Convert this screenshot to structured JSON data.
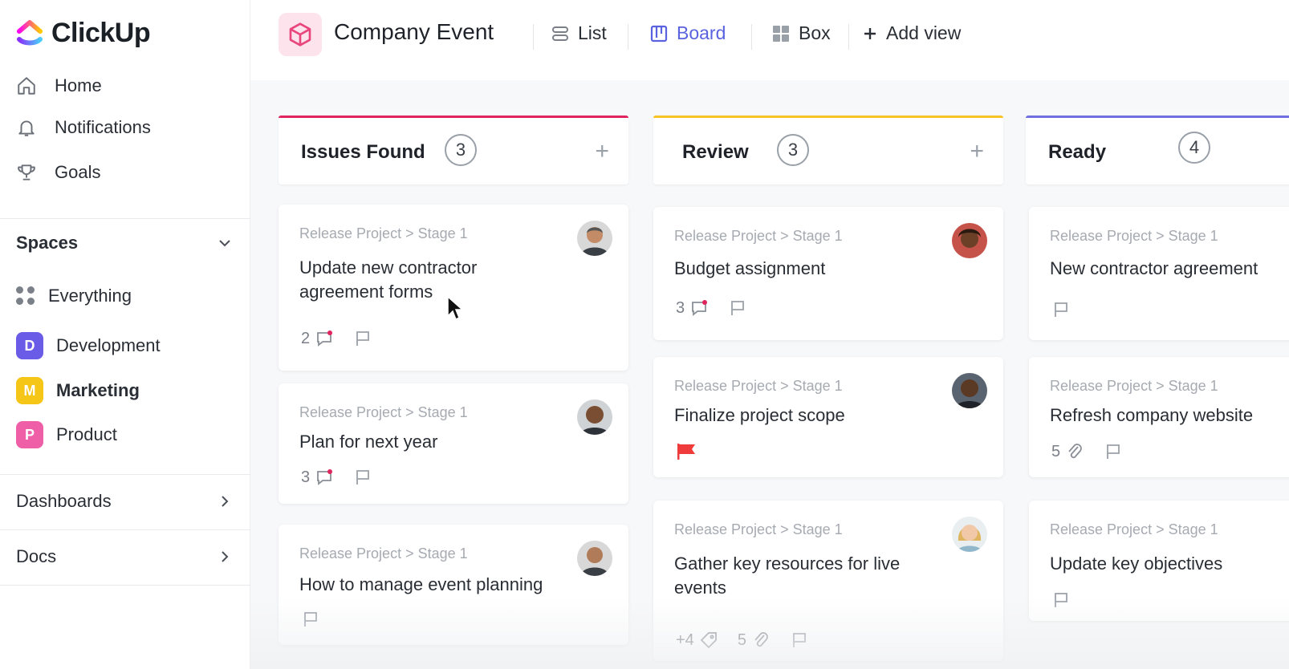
{
  "app": {
    "name": "ClickUp"
  },
  "sidebar": {
    "nav": [
      {
        "label": "Home",
        "icon": "home-icon"
      },
      {
        "label": "Notifications",
        "icon": "bell-icon"
      },
      {
        "label": "Goals",
        "icon": "trophy-icon"
      }
    ],
    "spaces_label": "Spaces",
    "everything_label": "Everything",
    "spaces": [
      {
        "letter": "D",
        "label": "Development",
        "color": "#6b5ce7"
      },
      {
        "letter": "M",
        "label": "Marketing",
        "color": "#f5c518"
      },
      {
        "letter": "P",
        "label": "Product",
        "color": "#ef5fa7"
      }
    ],
    "dashboards_label": "Dashboards",
    "docs_label": "Docs"
  },
  "header": {
    "project_title": "Company Event",
    "views": [
      {
        "label": "List"
      },
      {
        "label": "Board"
      },
      {
        "label": "Box"
      },
      {
        "label": "Add view"
      }
    ],
    "active_view": "Board",
    "accent": "#5b62e0"
  },
  "board": {
    "columns": [
      {
        "title": "Issues Found",
        "count": "3",
        "color": "#e0245e",
        "cards": [
          {
            "crumb": "Release Project > Stage 1",
            "title": "Update new contractor agreement forms",
            "comments": "2"
          },
          {
            "crumb": "Release Project > Stage 1",
            "title": "Plan for next year",
            "comments": "3"
          },
          {
            "crumb": "Release Project > Stage 1",
            "title": "How to manage event planning"
          }
        ]
      },
      {
        "title": "Review",
        "count": "3",
        "color": "#f7c325",
        "cards": [
          {
            "crumb": "Release Project > Stage 1",
            "title": "Budget assignment",
            "comments": "3"
          },
          {
            "crumb": "Release Project > Stage 1",
            "title": "Finalize project scope"
          },
          {
            "crumb": "Release Project > Stage 1",
            "title": "Gather key resources for live events",
            "tags": "+4",
            "attachments": "5"
          }
        ]
      },
      {
        "title": "Ready",
        "count": "4",
        "color": "#6f6fe0",
        "cards": [
          {
            "crumb": "Release Project > Stage 1",
            "title": "New contractor agreement"
          },
          {
            "crumb": "Release Project > Stage 1",
            "title": "Refresh company website",
            "attachments": "5"
          },
          {
            "crumb": "Release Project > Stage 1",
            "title": "Update key objectives"
          }
        ]
      }
    ]
  }
}
